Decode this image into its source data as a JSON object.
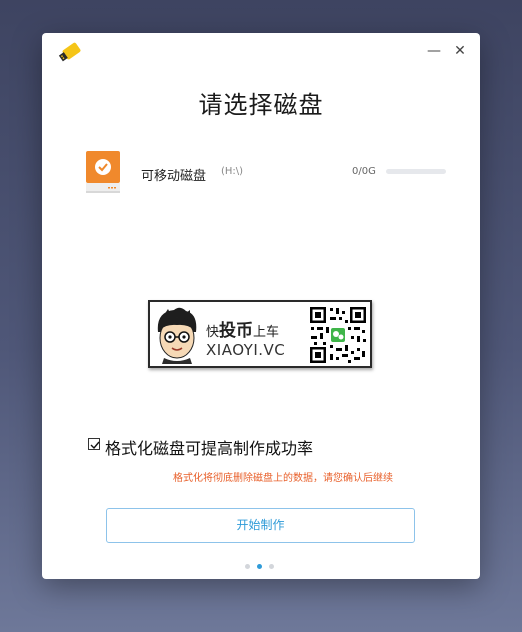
{
  "window": {
    "minimize_glyph": "—",
    "close_glyph": "✕"
  },
  "page": {
    "title": "请选择磁盘"
  },
  "disk": {
    "name": "可移动磁盘",
    "letter": "(H:\\)",
    "size": "0/0G",
    "usage_fraction": 0
  },
  "promo": {
    "text_prefix": "快",
    "text_big": "投币",
    "text_suffix": "上车",
    "domain": "XIAOYI.VC"
  },
  "options": {
    "format_label": "格式化磁盘可提高制作成功率",
    "format_checked": true,
    "warning": "格式化将彻底删除磁盘上的数据，请您确认后继续"
  },
  "actions": {
    "start_label": "开始制作"
  },
  "pager": {
    "count": 3,
    "active_index": 1
  },
  "colors": {
    "accent": "#2f9bd8",
    "warning": "#e8602b",
    "disk_icon": "#f0892c",
    "logo": "#f5c518"
  }
}
